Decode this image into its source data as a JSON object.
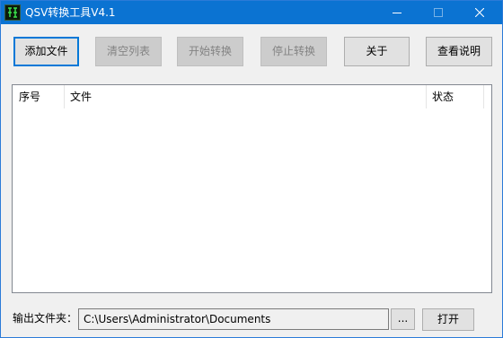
{
  "window": {
    "title": "QSV转换工具V4.1",
    "icon": "qsv-app-icon",
    "controls": [
      "minimize-icon",
      "maximize-icon",
      "close-icon"
    ]
  },
  "toolbar": {
    "add_files": "添加文件",
    "clear_list": "清空列表",
    "start_convert": "开始转换",
    "stop_convert": "停止转换",
    "about": "关于",
    "help": "查看说明"
  },
  "list": {
    "columns": [
      "序号",
      "文件",
      "状态"
    ],
    "rows": []
  },
  "output": {
    "label": "输出文件夹：",
    "path": "C:\\Users\\Administrator\\Documents",
    "browse_label": "...",
    "open_label": "打开"
  },
  "colors": {
    "titlebar": "#0b73d2",
    "focus_border": "#0078d7",
    "disabled_text": "#838383"
  }
}
